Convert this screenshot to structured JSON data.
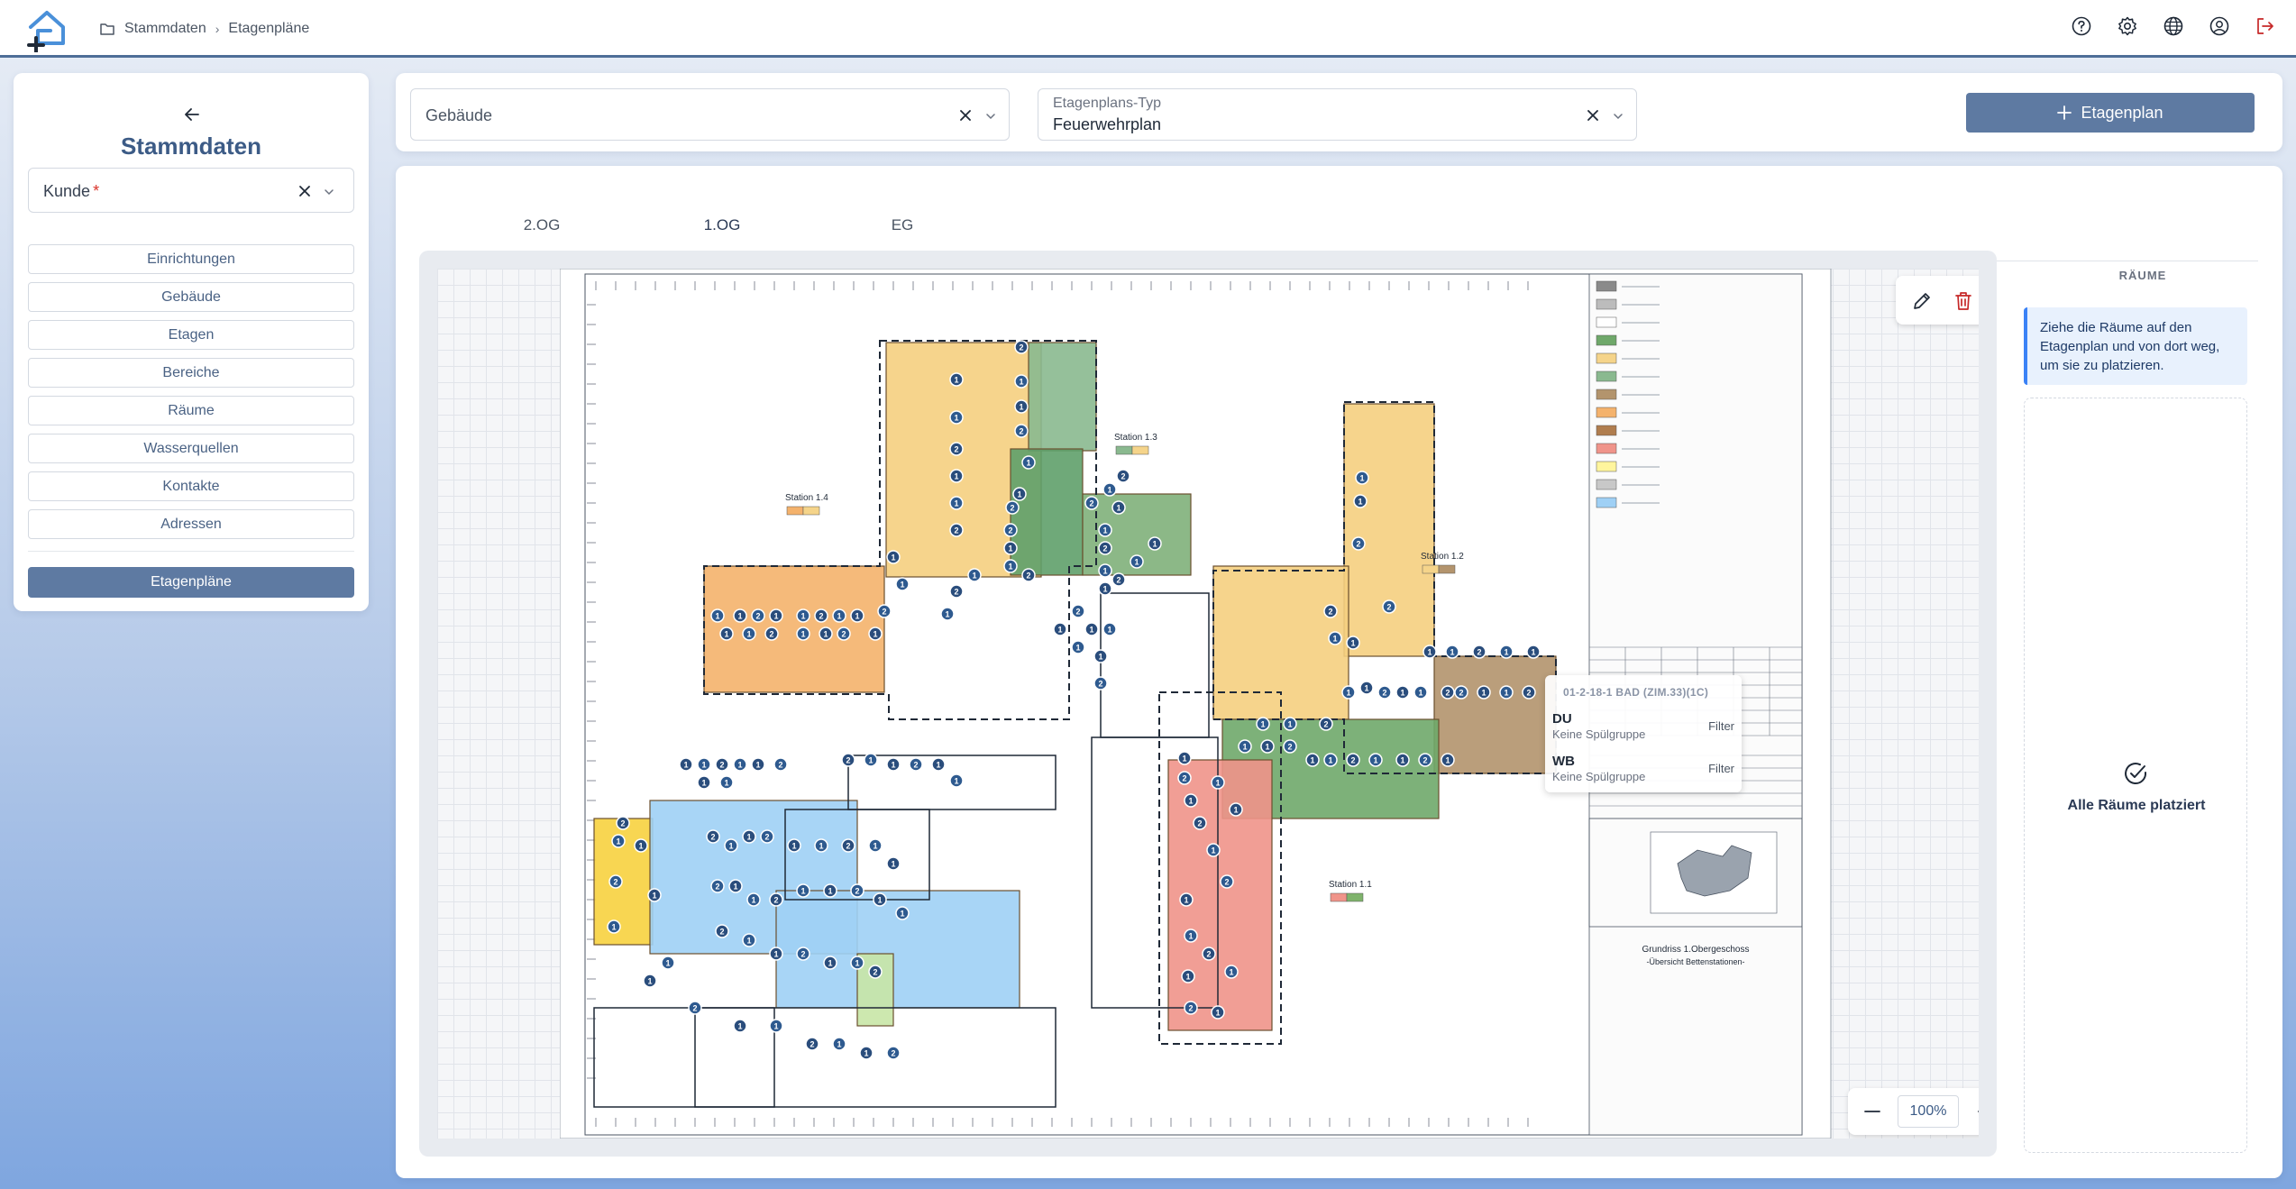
{
  "header": {
    "breadcrumb": [
      "Stammdaten",
      "Etagenpläne"
    ],
    "icons": [
      "help-icon",
      "settings-gear-icon",
      "globe-icon",
      "user-account-icon",
      "logout-icon"
    ]
  },
  "sidebar": {
    "title": "Stammdaten",
    "kunde_label": "Kunde",
    "kunde_required_mark": "*",
    "items": [
      "Einrichtungen",
      "Gebäude",
      "Etagen",
      "Bereiche",
      "Räume",
      "Wasserquellen",
      "Kontakte",
      "Adressen"
    ],
    "active_item": "Etagenpläne"
  },
  "filters": {
    "gebaeude_placeholder": "Gebäude",
    "typ_label": "Etagenplans-Typ",
    "typ_value": "Feuerwehrplan",
    "add_button": "Etagenplan"
  },
  "tabs": [
    "2.OG",
    "1.OG",
    "EG"
  ],
  "active_tab": "1.OG",
  "plan": {
    "zoom": "100%",
    "stations": [
      "Station 1.4",
      "Station 1.3",
      "Station 1.2",
      "Station 1.1"
    ],
    "labels": {
      "title_block": "Grundriss 1.Obergeschoss",
      "subtitle_block": "-Übersicht Bettenstationen-"
    },
    "popup": {
      "title": "01-2-18-1 BAD (ZIM.33)(1C)",
      "entries": [
        {
          "name": "DU",
          "group": "Keine Spülgruppe",
          "action": "Filter"
        },
        {
          "name": "WB",
          "group": "Keine Spülgruppe",
          "action": "Filter"
        }
      ]
    }
  },
  "rooms": {
    "heading": "RÄUME",
    "info": "Ziehe die Räume auf den Etagenplan und von dort weg, um sie zu platzieren.",
    "done_text": "Alle Räume platziert"
  },
  "colors": {
    "accent": "#5e7aa2",
    "title": "#3c5b86",
    "header_border": "#4e6e98",
    "info_border": "#3b82f6",
    "delete": "#c62828"
  }
}
